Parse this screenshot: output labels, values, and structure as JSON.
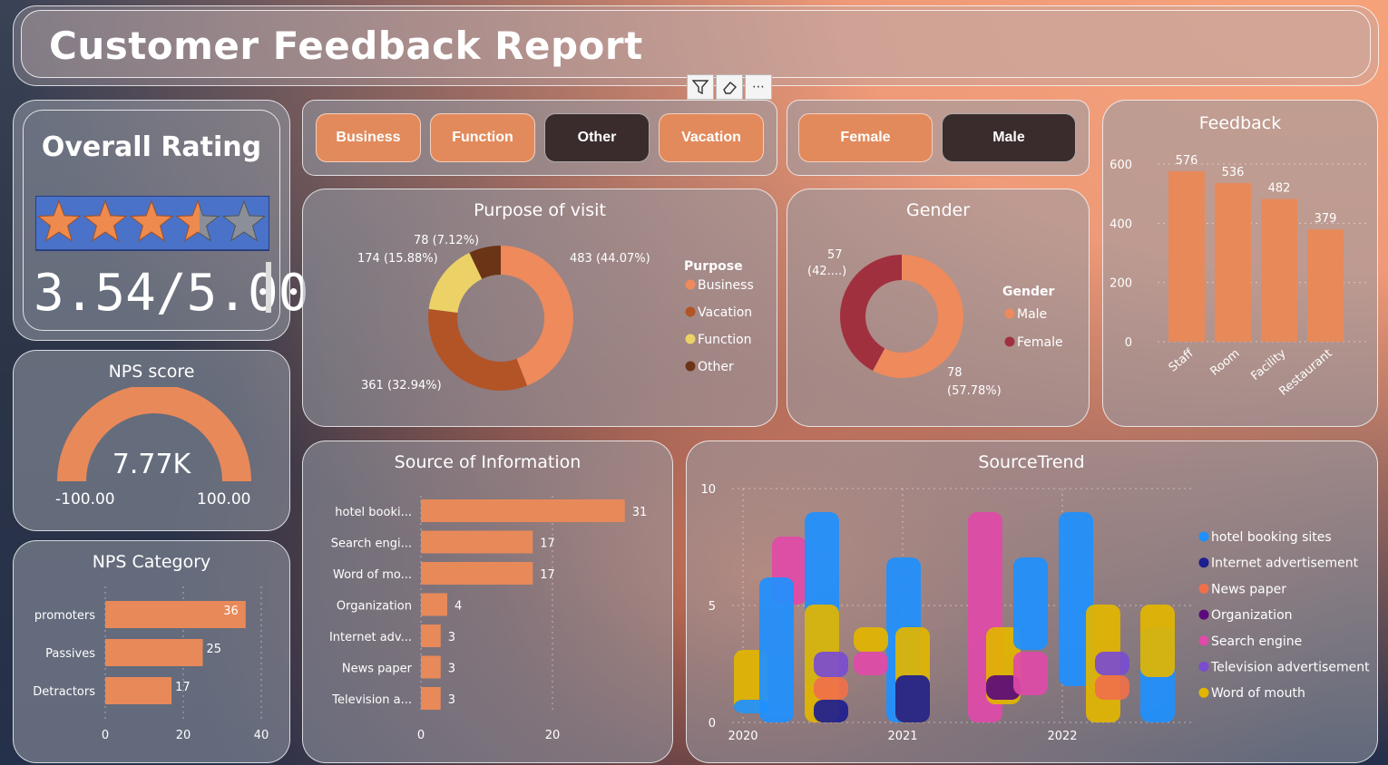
{
  "title": "Customer Feedback Report",
  "rating": {
    "title": "Overall Rating",
    "value_text": "3.54/5.00",
    "stars": 3.54,
    "max": 5
  },
  "nps_score": {
    "title": "NPS score",
    "value": "7.77K",
    "min_label": "-100.00",
    "max_label": "100.00"
  },
  "purpose_slicer": {
    "items": [
      {
        "label": "Business",
        "selected": false
      },
      {
        "label": "Function",
        "selected": false
      },
      {
        "label": "Other",
        "selected": true
      },
      {
        "label": "Vacation",
        "selected": false
      }
    ]
  },
  "gender_slicer": {
    "items": [
      {
        "label": "Female",
        "selected": false
      },
      {
        "label": "Male",
        "selected": true
      }
    ]
  },
  "toolbar": {
    "icons": [
      "filter-icon",
      "eraser-icon",
      "more-options-icon"
    ]
  },
  "colors": {
    "accent": "#e8895a",
    "business": "#ee8a5c",
    "vacation": "#b35427",
    "function": "#ecd266",
    "other": "#6b3417",
    "male": "#ee8a5c",
    "female": "#a1303f",
    "hotel": "#1e90ff",
    "internet": "#1d1e8f",
    "newspaper": "#f0704a",
    "organization": "#5a0a7a",
    "search": "#e04aa8",
    "television": "#7a4cd0",
    "word": "#e2b500"
  },
  "chart_data": [
    {
      "id": "purpose",
      "type": "pie",
      "title": "Purpose of visit",
      "legend_title": "Purpose",
      "categories": [
        "Business",
        "Vacation",
        "Function",
        "Other"
      ],
      "values": [
        483,
        361,
        174,
        78
      ],
      "labels": [
        "483 (44.07%)",
        "361 (32.94%)",
        "174 (15.88%)",
        "78 (7.12%)"
      ]
    },
    {
      "id": "gender",
      "type": "pie",
      "title": "Gender",
      "legend_title": "Gender",
      "categories": [
        "Male",
        "Female"
      ],
      "values": [
        78,
        57
      ],
      "labels": [
        "78 (57.78%)",
        "57 (42....)"
      ]
    },
    {
      "id": "feedback",
      "type": "bar",
      "title": "Feedback",
      "categories": [
        "Staff",
        "Room",
        "Facility",
        "Restaurant"
      ],
      "values": [
        576,
        536,
        482,
        379
      ],
      "ylim": [
        0,
        600
      ],
      "yticks": [
        0,
        200,
        400,
        600
      ]
    },
    {
      "id": "nps_category",
      "type": "bar",
      "orientation": "horizontal",
      "title": "NPS Category",
      "categories": [
        "promoters",
        "Passives",
        "Detractors"
      ],
      "values": [
        36,
        25,
        17
      ],
      "xlim": [
        0,
        40
      ],
      "xticks": [
        0,
        20,
        40
      ]
    },
    {
      "id": "source_info",
      "type": "bar",
      "orientation": "horizontal",
      "title": "Source of Information",
      "categories": [
        "hotel booki...",
        "Search engi...",
        "Word of mo...",
        "Organization",
        "Internet adv...",
        "News paper",
        "Television a..."
      ],
      "values": [
        31,
        17,
        17,
        4,
        3,
        3,
        3
      ],
      "xticks": [
        0,
        20
      ]
    },
    {
      "id": "source_trend",
      "type": "area",
      "title": "SourceTrend",
      "x": [
        "2020",
        "2021",
        "2022"
      ],
      "yticks": [
        0,
        5,
        10
      ],
      "series": [
        {
          "name": "hotel booking sites"
        },
        {
          "name": "Internet advertisement"
        },
        {
          "name": "News paper"
        },
        {
          "name": "Organization"
        },
        {
          "name": "Search engine"
        },
        {
          "name": "Television advertisement"
        },
        {
          "name": "Word of mouth"
        }
      ]
    }
  ]
}
